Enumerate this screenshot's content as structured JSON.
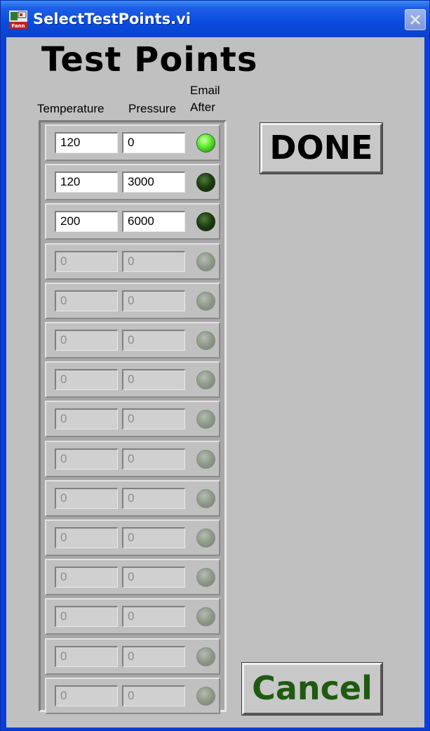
{
  "window": {
    "title": "SelectTestPoints.vi",
    "app_icon": "labview-vi-icon",
    "close_icon": "close-icon"
  },
  "heading": "Test Points",
  "columns": {
    "temperature": "Temperature",
    "pressure": "Pressure",
    "email_after_line1": "Email",
    "email_after_line2": "After"
  },
  "rows": [
    {
      "temperature": "120",
      "pressure": "0",
      "email_after": "on",
      "enabled": true
    },
    {
      "temperature": "120",
      "pressure": "3000",
      "email_after": "off",
      "enabled": true
    },
    {
      "temperature": "200",
      "pressure": "6000",
      "email_after": "off",
      "enabled": true
    },
    {
      "temperature": "0",
      "pressure": "0",
      "email_after": "disabled",
      "enabled": false
    },
    {
      "temperature": "0",
      "pressure": "0",
      "email_after": "disabled",
      "enabled": false
    },
    {
      "temperature": "0",
      "pressure": "0",
      "email_after": "disabled",
      "enabled": false
    },
    {
      "temperature": "0",
      "pressure": "0",
      "email_after": "disabled",
      "enabled": false
    },
    {
      "temperature": "0",
      "pressure": "0",
      "email_after": "disabled",
      "enabled": false
    },
    {
      "temperature": "0",
      "pressure": "0",
      "email_after": "disabled",
      "enabled": false
    },
    {
      "temperature": "0",
      "pressure": "0",
      "email_after": "disabled",
      "enabled": false
    },
    {
      "temperature": "0",
      "pressure": "0",
      "email_after": "disabled",
      "enabled": false
    },
    {
      "temperature": "0",
      "pressure": "0",
      "email_after": "disabled",
      "enabled": false
    },
    {
      "temperature": "0",
      "pressure": "0",
      "email_after": "disabled",
      "enabled": false
    },
    {
      "temperature": "0",
      "pressure": "0",
      "email_after": "disabled",
      "enabled": false
    },
    {
      "temperature": "0",
      "pressure": "0",
      "email_after": "disabled",
      "enabled": false
    }
  ],
  "buttons": {
    "done": "DONE",
    "cancel": "Cancel"
  },
  "colors": {
    "panel_background": "#c0c0c0",
    "titlebar": "#0a4bdf",
    "led_on": "#6cf23a",
    "led_off": "#1c3d10",
    "cancel_text": "#1f5a10"
  }
}
